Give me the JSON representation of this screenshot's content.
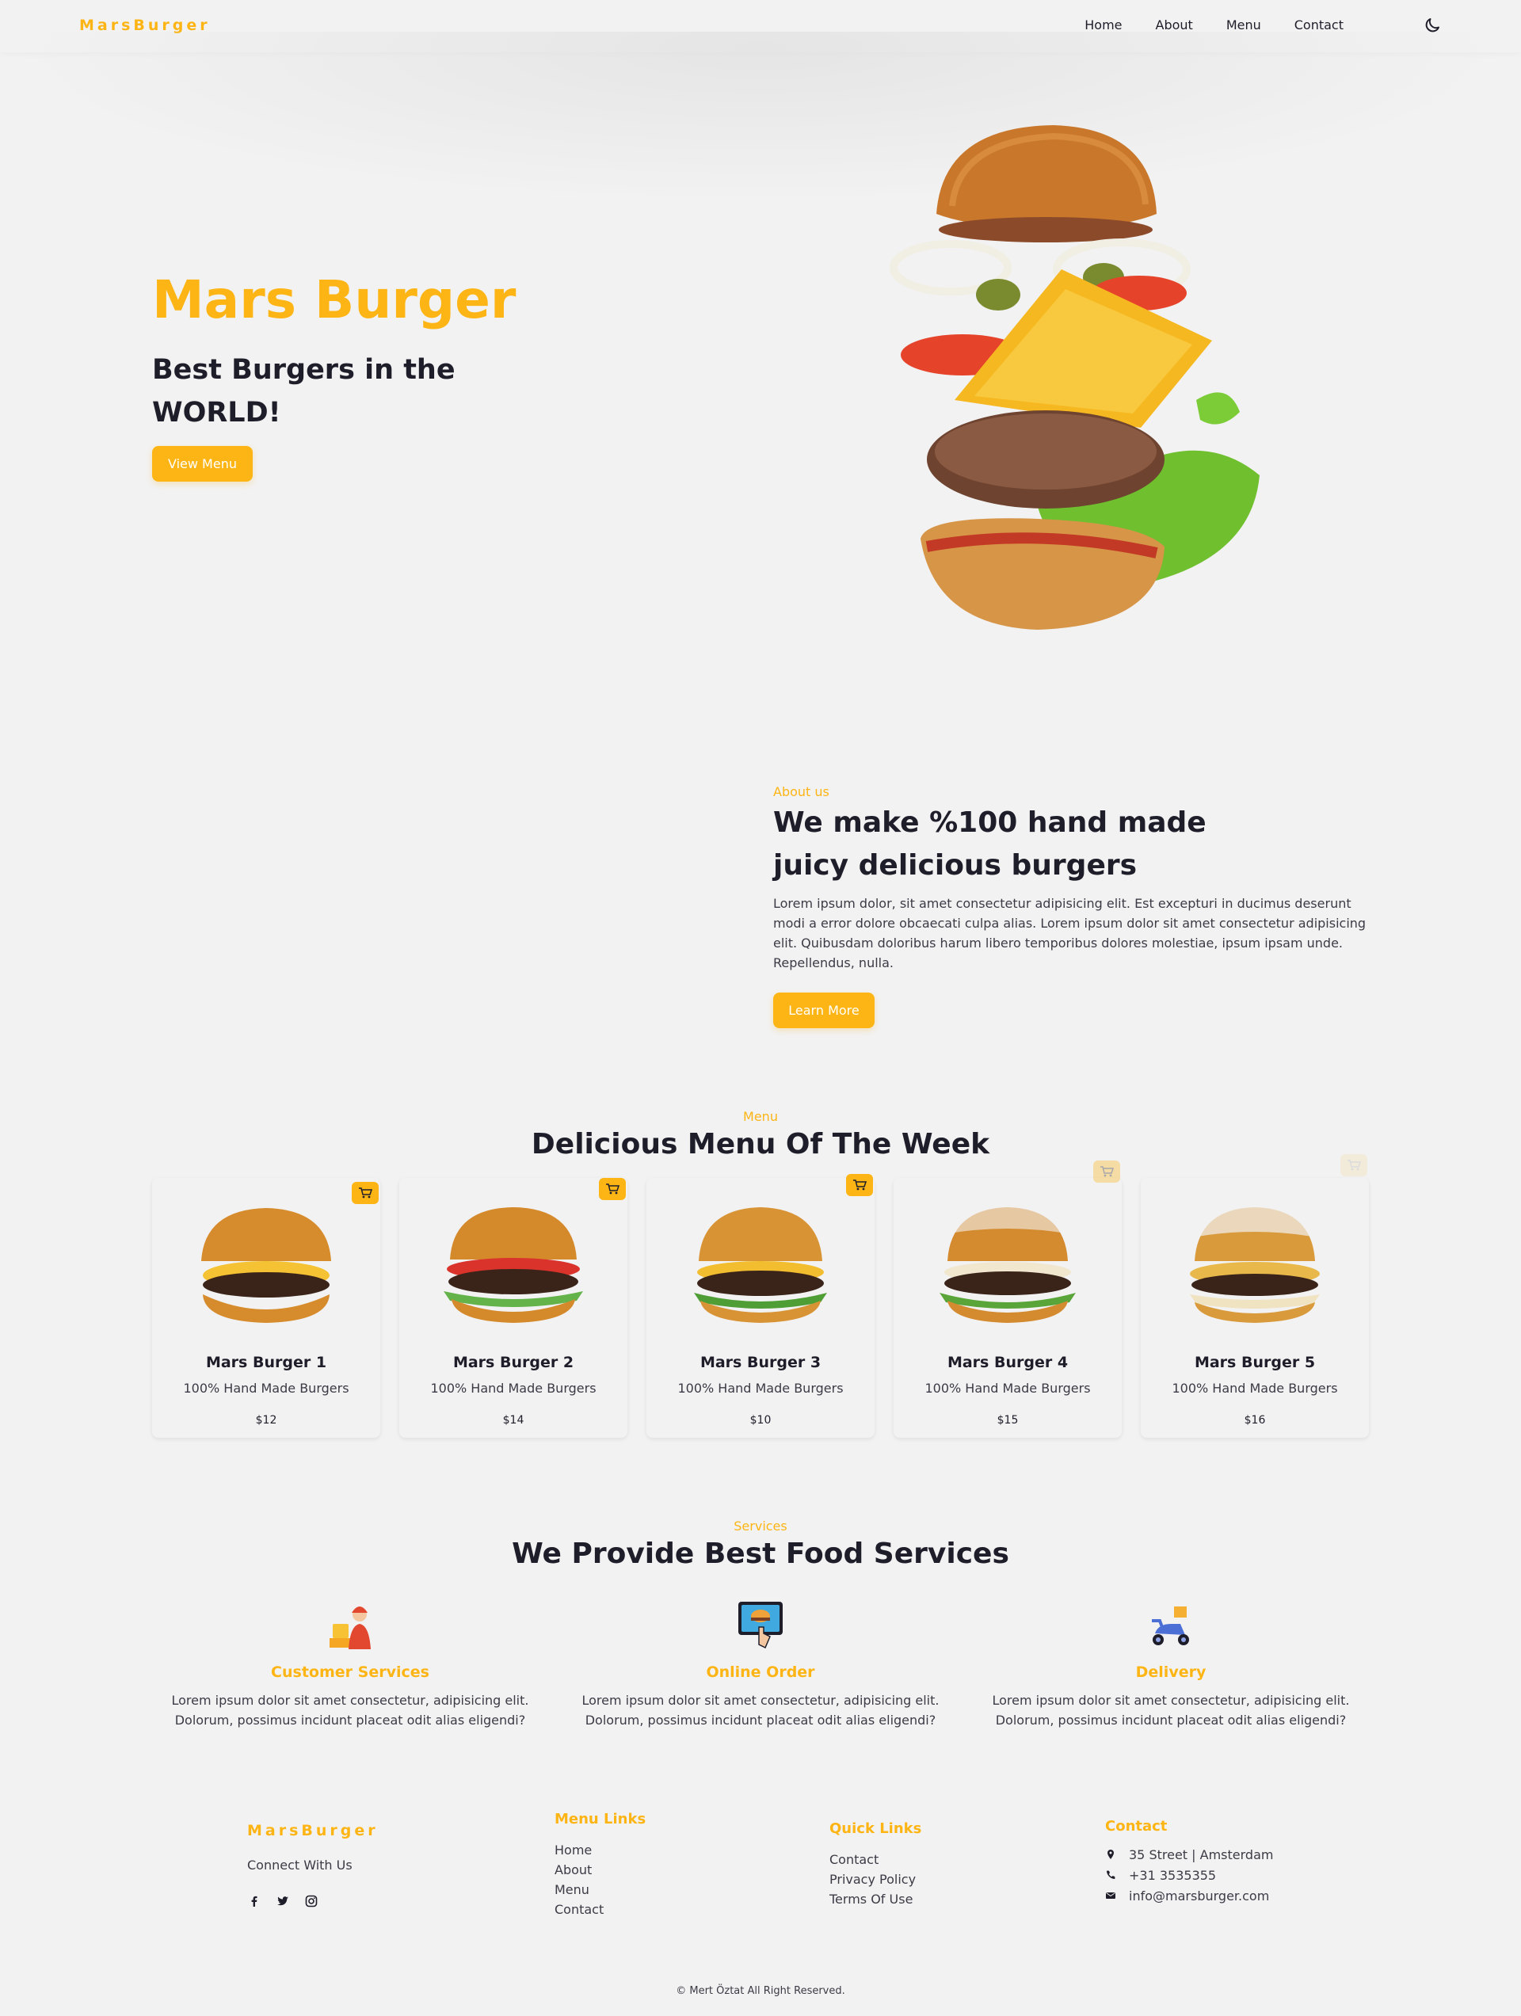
{
  "brand": {
    "name": "MarsBurger",
    "accent": "#fdb515",
    "text": "#1e1e2a",
    "background": "#f2f2f2"
  },
  "nav": {
    "items": [
      "Home",
      "About",
      "Menu",
      "Contact"
    ],
    "theme_icon": "moon-icon"
  },
  "hero": {
    "title": "Mars Burger",
    "subtitle": "Best Burgers in the WORLD!",
    "button": "View Menu"
  },
  "about": {
    "tag": "About us",
    "title": "We make %100 hand made juicy delicious burgers",
    "text": "Lorem ipsum dolor, sit amet consectetur adipisicing elit. Est excepturi in ducimus deserunt modi a error dolore obcaecati culpa alias. Lorem ipsum dolor sit amet consectetur adipisicing elit. Quibusdam doloribus harum libero temporibus dolores molestiae, ipsum ipsam unde. Repellendus, nulla.",
    "button": "Learn More"
  },
  "menu": {
    "tag": "Menu",
    "title": "Delicious Menu Of The Week",
    "items": [
      {
        "name": "Mars Burger 1",
        "desc": "100% Hand Made Burgers",
        "price": "$12"
      },
      {
        "name": "Mars Burger 2",
        "desc": "100% Hand Made Burgers",
        "price": "$14"
      },
      {
        "name": "Mars Burger 3",
        "desc": "100% Hand Made Burgers",
        "price": "$10"
      },
      {
        "name": "Mars Burger 4",
        "desc": "100% Hand Made Burgers",
        "price": "$15"
      },
      {
        "name": "Mars Burger 5",
        "desc": "100% Hand Made Burgers",
        "price": "$16"
      }
    ],
    "cart_icon": "cart-icon"
  },
  "services": {
    "tag": "Services",
    "title": "We Provide Best Food Services",
    "items": [
      {
        "title": "Customer Services",
        "text": "Lorem ipsum dolor sit amet consectetur, adipisicing elit. Dolorum, possimus incidunt placeat odit alias eligendi?",
        "icon": "cashier-icon"
      },
      {
        "title": "Online Order",
        "text": "Lorem ipsum dolor sit amet consectetur, adipisicing elit. Dolorum, possimus incidunt placeat odit alias eligendi?",
        "icon": "online-order-icon"
      },
      {
        "title": "Delivery",
        "text": "Lorem ipsum dolor sit amet consectetur, adipisicing elit. Dolorum, possimus incidunt placeat odit alias eligendi?",
        "icon": "scooter-icon"
      }
    ]
  },
  "footer": {
    "logo": "MarsBurger",
    "connect": "Connect With Us",
    "social": [
      "facebook-icon",
      "twitter-icon",
      "instagram-icon"
    ],
    "menu_links": {
      "title": "Menu Links",
      "items": [
        "Home",
        "About",
        "Menu",
        "Contact"
      ]
    },
    "quick_links": {
      "title": "Quick Links",
      "items": [
        "Contact",
        "Privacy Policy",
        "Terms Of Use"
      ]
    },
    "contact": {
      "title": "Contact",
      "address": "35 Street | Amsterdam",
      "phone": "+31 3535355",
      "email": "info@marsburger.com"
    },
    "copyright": "© Mert Öztat All Right Reserved."
  }
}
